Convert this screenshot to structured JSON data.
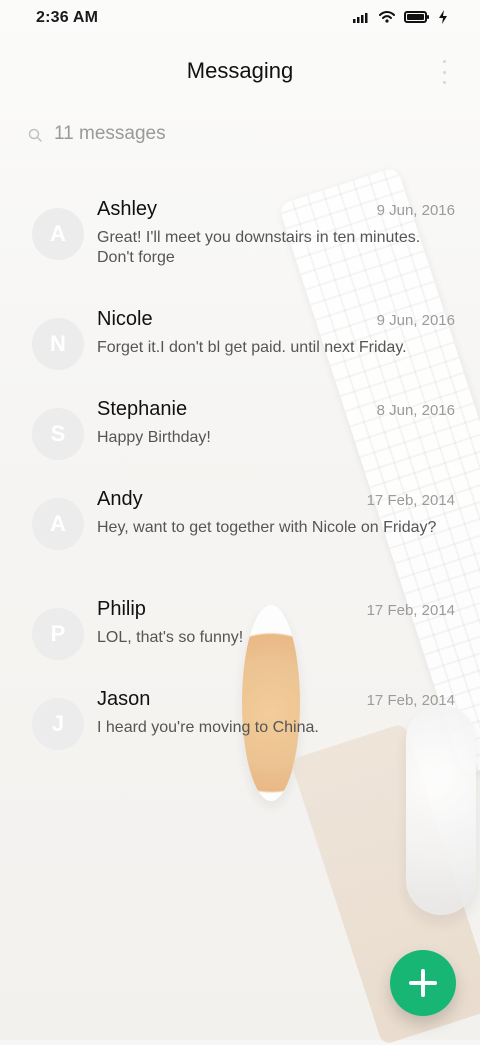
{
  "status_bar": {
    "time": "2:36 AM",
    "icons": [
      "signal-icon",
      "wifi-icon",
      "battery-icon",
      "charging-icon"
    ]
  },
  "header": {
    "title": "Messaging",
    "more_icon": "more-vert-icon"
  },
  "subheader": {
    "count_label": "11 messages"
  },
  "messages": [
    {
      "initial": "A",
      "name": "Ashley",
      "date": "9 Jun, 2016",
      "snippet": "Great! I'll meet you downstairs in ten minutes. Don't forge"
    },
    {
      "initial": "N",
      "name": "Nicole",
      "date": "9 Jun, 2016",
      "snippet": "Forget it.I don't bl get paid. until next Friday."
    },
    {
      "initial": "S",
      "name": "Stephanie",
      "date": "8 Jun, 2016",
      "snippet": "Happy Birthday!"
    },
    {
      "initial": "A",
      "name": "Andy",
      "date": "17 Feb, 2014",
      "snippet": "Hey, want to get together with Nicole on Friday?"
    },
    {
      "initial": "P",
      "name": "Philip",
      "date": "17 Feb, 2014",
      "snippet": "LOL, that's so funny!"
    },
    {
      "initial": "J",
      "name": "Jason",
      "date": "17 Feb, 2014",
      "snippet": "I heard you're moving to China."
    }
  ],
  "fab": {
    "icon": "add-icon",
    "color": "#18b675"
  }
}
